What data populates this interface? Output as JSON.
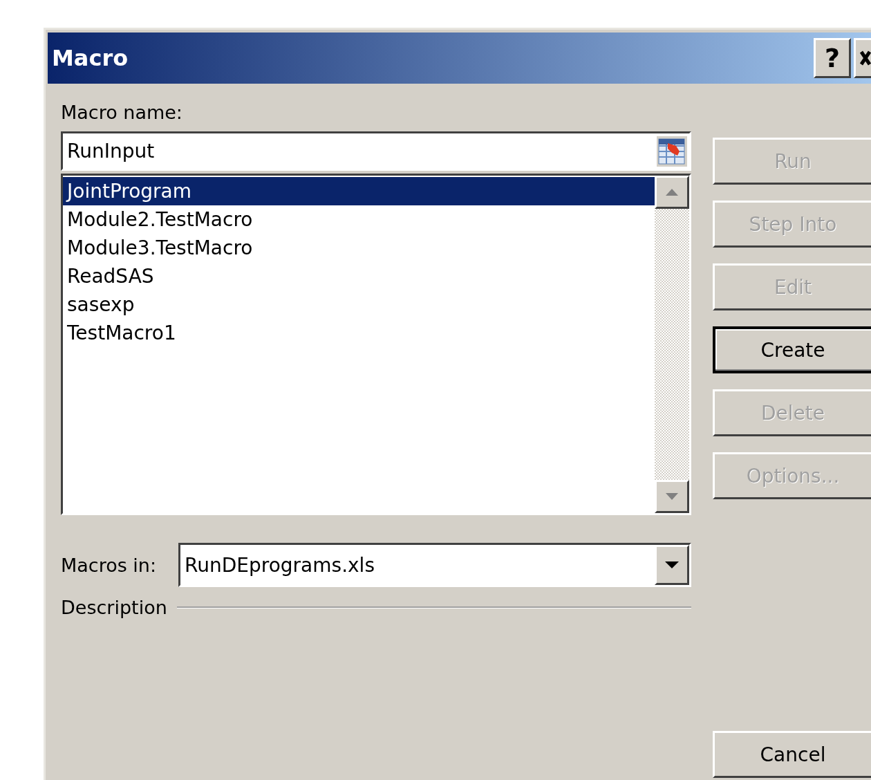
{
  "window": {
    "title": "Macro",
    "help_button": "?"
  },
  "macro_name": {
    "label": "Macro name:",
    "value": "RunInput"
  },
  "macro_list": [
    {
      "label": "JointProgram",
      "selected": true
    },
    {
      "label": "Module2.TestMacro",
      "selected": false
    },
    {
      "label": "Module3.TestMacro",
      "selected": false
    },
    {
      "label": "ReadSAS",
      "selected": false
    },
    {
      "label": "sasexp",
      "selected": false
    },
    {
      "label": "TestMacro1",
      "selected": false
    }
  ],
  "macros_in": {
    "label": "Macros in:",
    "value": "RunDEprograms.xls"
  },
  "description": {
    "label": "Description"
  },
  "buttons": [
    {
      "label": "Run",
      "disabled": true,
      "default": false
    },
    {
      "label": "Step Into",
      "disabled": true,
      "default": false
    },
    {
      "label": "Edit",
      "disabled": true,
      "default": false
    },
    {
      "label": "Create",
      "disabled": false,
      "default": true
    },
    {
      "label": "Delete",
      "disabled": true,
      "default": false
    },
    {
      "label": "Options...",
      "disabled": true,
      "default": false
    }
  ],
  "cancel_button": {
    "label": "Cancel"
  }
}
